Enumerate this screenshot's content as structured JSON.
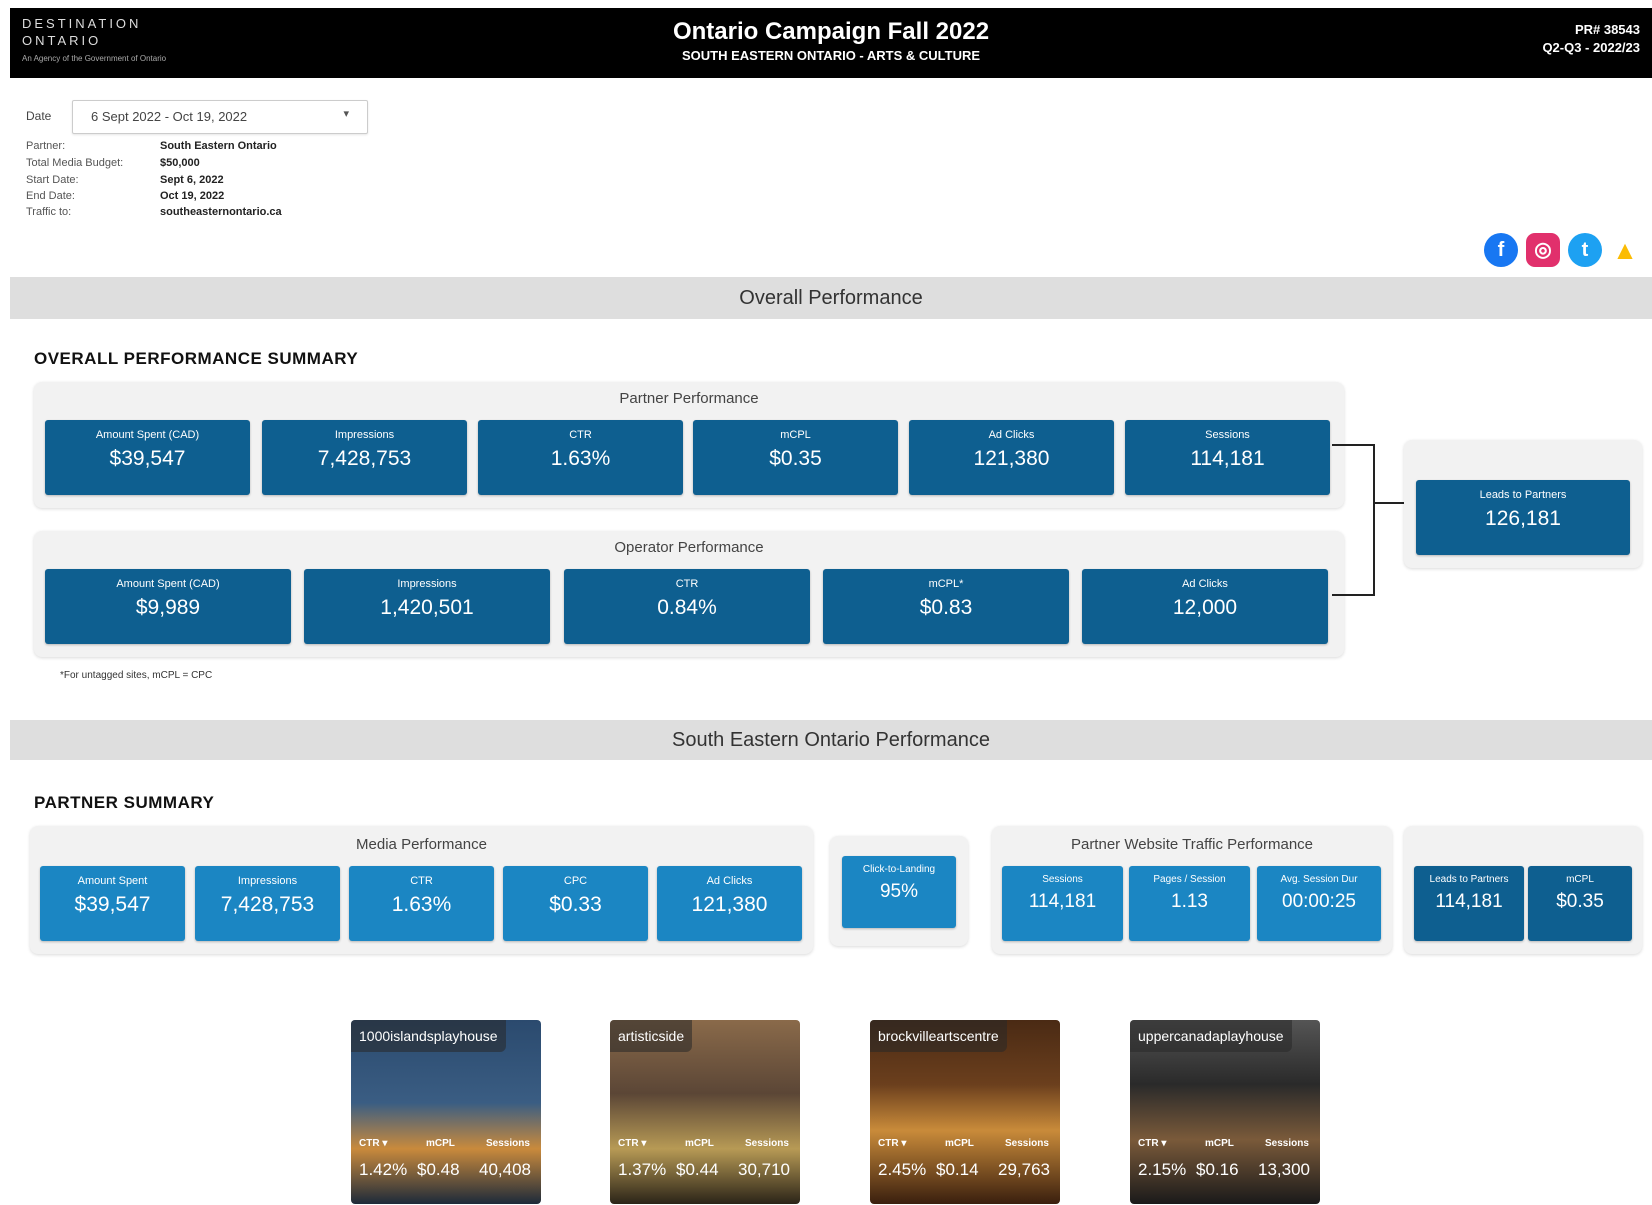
{
  "header": {
    "brand_line1": "DESTINATION",
    "brand_line2": "ONTARIO",
    "brand_line3": "An Agency of the Government of Ontario",
    "title": "Ontario Campaign Fall 2022",
    "subtitle": "SOUTH EASTERN ONTARIO - ARTS & CULTURE",
    "pr_number": "PR# 38543",
    "period": "Q2-Q3 - 2022/23"
  },
  "filter": {
    "date_label": "Date",
    "date_value": "6 Sept 2022  - Oct 19, 2022",
    "caret": "▾"
  },
  "info": [
    {
      "key": "Partner:",
      "value": "South Eastern Ontario"
    },
    {
      "key": "Total Media Budget:",
      "value": "$50,000"
    },
    {
      "key": "Start Date:",
      "value": "Sept 6, 2022"
    },
    {
      "key": "End Date:",
      "value": "Oct 19, 2022"
    },
    {
      "key": "Traffic to:",
      "value": "southeasternontario.ca"
    }
  ],
  "social_icons": [
    {
      "name": "facebook-icon",
      "glyph": "f",
      "color": "#1877f2"
    },
    {
      "name": "instagram-icon",
      "glyph": "◎",
      "color": "#e1306c"
    },
    {
      "name": "twitter-icon",
      "glyph": "t",
      "color": "#1da1f2"
    },
    {
      "name": "google-ads-icon",
      "glyph": "▲",
      "color": "#fbbc04"
    }
  ],
  "overall": {
    "section_title": "Overall Performance",
    "heading": "OVERALL PERFORMANCE SUMMARY",
    "partner_title": "Partner Performance",
    "partner_kpis": [
      {
        "label": "Amount Spent (CAD)",
        "value": "$39,547"
      },
      {
        "label": "Impressions",
        "value": "7,428,753"
      },
      {
        "label": "CTR",
        "value": "1.63%"
      },
      {
        "label": "mCPL",
        "value": "$0.35"
      },
      {
        "label": "Ad Clicks",
        "value": "121,380"
      },
      {
        "label": "Sessions",
        "value": "114,181"
      }
    ],
    "operator_title": "Operator Performance",
    "operator_kpis": [
      {
        "label": "Amount Spent (CAD)",
        "value": "$9,989"
      },
      {
        "label": "Impressions",
        "value": "1,420,501"
      },
      {
        "label": "CTR",
        "value": "0.84%"
      },
      {
        "label": "mCPL*",
        "value": "$0.83"
      },
      {
        "label": "Ad Clicks",
        "value": "12,000"
      }
    ],
    "leads": {
      "label": "Leads to Partners",
      "value": "126,181"
    },
    "footnote": "*For untagged sites, mCPL = CPC"
  },
  "seo": {
    "section_title": "South Eastern Ontario Performance",
    "heading": "PARTNER SUMMARY",
    "media_title": "Media Performance",
    "media_kpis": [
      {
        "label": "Amount Spent",
        "value": "$39,547"
      },
      {
        "label": "Impressions",
        "value": "7,428,753"
      },
      {
        "label": "CTR",
        "value": "1.63%"
      },
      {
        "label": "CPC",
        "value": "$0.33"
      },
      {
        "label": "Ad Clicks",
        "value": "121,380"
      }
    ],
    "click_landing": {
      "label": "Click-to-Landing",
      "value": "95%"
    },
    "traffic_title": "Partner Website Traffic Performance",
    "traffic_kpis": [
      {
        "label": "Sessions",
        "value": "114,181"
      },
      {
        "label": "Pages / Session",
        "value": "1.13"
      },
      {
        "label": "Avg. Session Dur",
        "value": "00:00:25"
      }
    ],
    "lead_kpis": [
      {
        "label": "Leads to Partners",
        "value": "114,181"
      },
      {
        "label": "mCPL",
        "value": "$0.35"
      }
    ]
  },
  "tiles": [
    {
      "name": "1000islandsplayhouse",
      "k1": "CTR ▾",
      "k2": "mCPL",
      "k3": "Sessions",
      "v1": "1.42%",
      "v2": "$0.48",
      "v3": "40,408",
      "c1": "#3a5d83",
      "c2": "#c98a3c"
    },
    {
      "name": "artisticside",
      "k1": "CTR ▾",
      "k2": "mCPL",
      "k3": "Sessions",
      "v1": "1.37%",
      "v2": "$0.44",
      "v3": "30,710",
      "c1": "#5b4636",
      "c2": "#b79a55"
    },
    {
      "name": "brockvilleartscentre",
      "k1": "CTR ▾",
      "k2": "mCPL",
      "k3": "Sessions",
      "v1": "2.45%",
      "v2": "$0.14",
      "v3": "29,763",
      "c1": "#6b3f1d",
      "c2": "#c98b3a"
    },
    {
      "name": "uppercanadaplayhouse",
      "k1": "CTR ▾",
      "k2": "mCPL",
      "k3": "Sessions",
      "v1": "2.15%",
      "v2": "$0.16",
      "v3": "13,300",
      "c1": "#2a2a2a",
      "c2": "#7a5a3a"
    }
  ]
}
